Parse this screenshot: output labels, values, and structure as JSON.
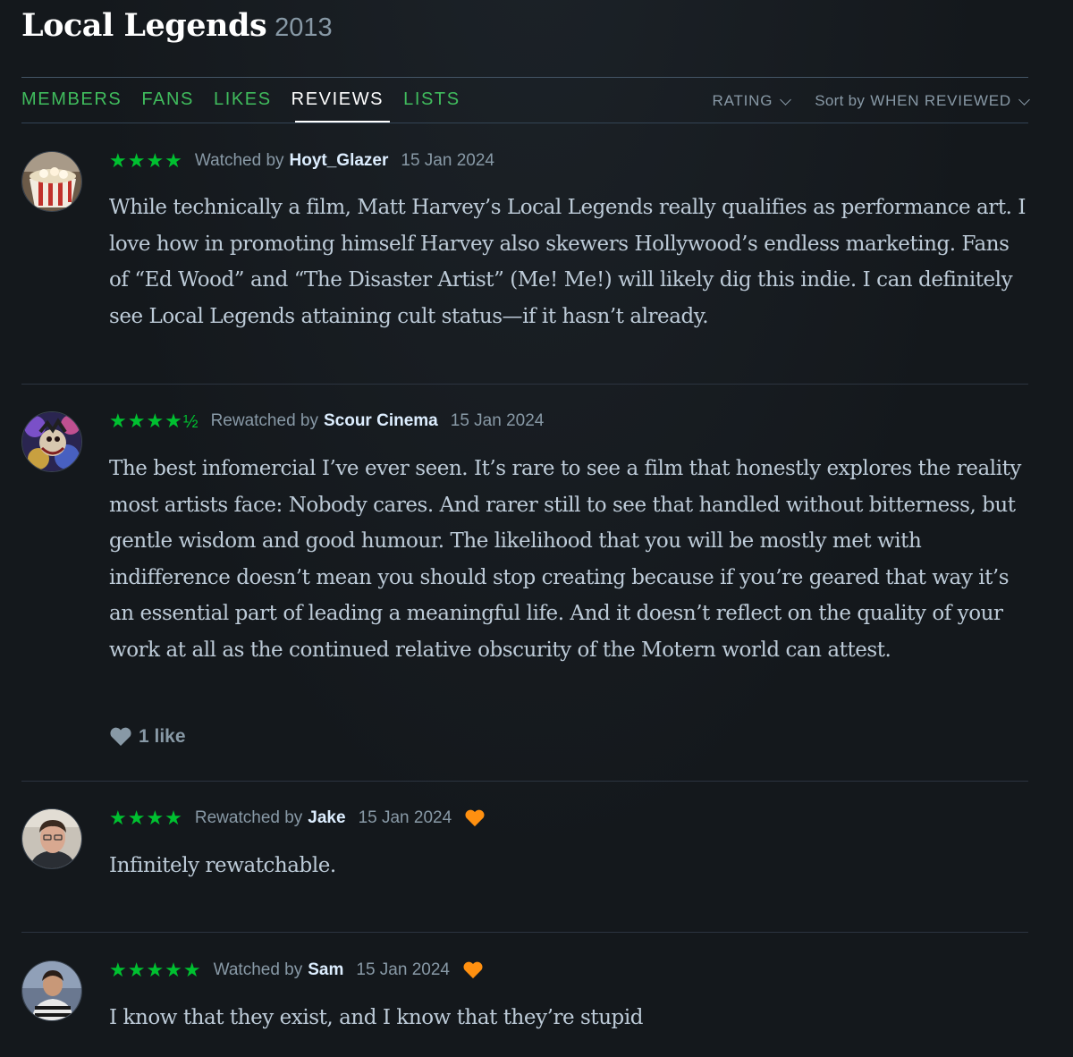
{
  "film": {
    "title": "Local Legends",
    "year": "2013"
  },
  "tabs": [
    {
      "label": "MEMBERS",
      "active": false
    },
    {
      "label": "FANS",
      "active": false
    },
    {
      "label": "LIKES",
      "active": false
    },
    {
      "label": "REVIEWS",
      "active": true
    },
    {
      "label": "LISTS",
      "active": false
    }
  ],
  "filters": {
    "rating_label": "RATING",
    "sort_prefix": "Sort by",
    "sort_value": "WHEN REVIEWED"
  },
  "colors": {
    "accent_green": "#00c030",
    "tab_green": "#40bc5d",
    "heart_orange": "#ff9010",
    "background": "#14181c"
  },
  "reviews": [
    {
      "stars": "★★★★",
      "half": "",
      "action": "Watched by",
      "user": "Hoyt_Glazer",
      "date": "15 Jan 2024",
      "liked": false,
      "text": "While technically a film, Matt Harvey’s Local Legends really qualifies as performance art. I love how in promoting himself Harvey also skewers Hollywood’s endless marketing. Fans of “Ed Wood” and “The Disaster Artist” (Me! Me!) will likely dig this indie. I can definitely see Local Legends attaining cult status—if it hasn’t already.",
      "likes": ""
    },
    {
      "stars": "★★★★",
      "half": "½",
      "action": "Rewatched by",
      "user": "Scour Cinema",
      "date": "15 Jan 2024",
      "liked": false,
      "text": "The best infomercial I’ve ever seen. It’s rare to see a film that honestly explores the reality most artists face: Nobody cares. And rarer still to see that handled without bitterness, but gentle wisdom and good humour. The likelihood that you will be mostly met with indifference doesn’t mean you should stop creating because if you’re geared that way it’s an essential part of leading a meaningful life. And it doesn’t reflect on the quality of your work at all as the continued relative obscurity of the Motern world can attest.",
      "likes": "1 like"
    },
    {
      "stars": "★★★★",
      "half": "",
      "action": "Rewatched by",
      "user": "Jake",
      "date": "15 Jan 2024",
      "liked": true,
      "text": "Infinitely rewatchable.",
      "likes": ""
    },
    {
      "stars": "★★★★★",
      "half": "",
      "action": "Watched by",
      "user": "Sam",
      "date": "15 Jan 2024",
      "liked": true,
      "text": "I know that they exist, and I know that they’re stupid",
      "likes": ""
    }
  ]
}
